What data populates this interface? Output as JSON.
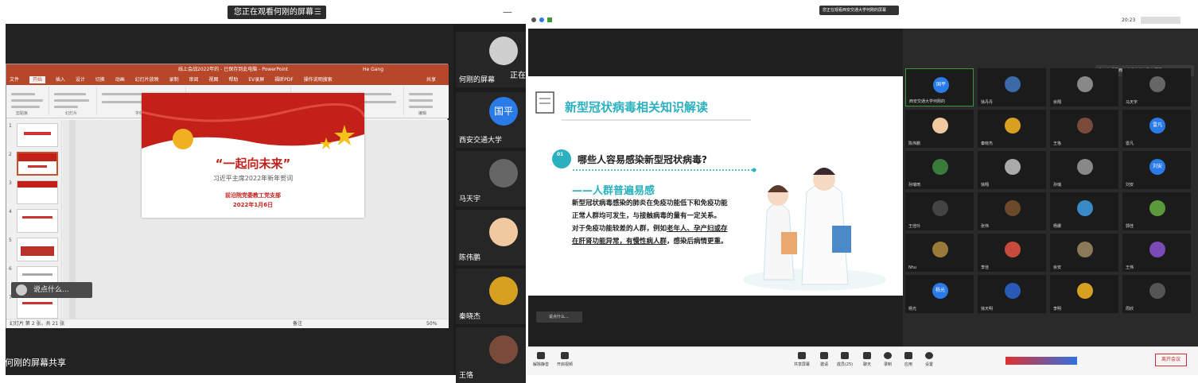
{
  "left": {
    "share_pill": "您正在观看何刚的屏幕",
    "minimize": "—",
    "tiles": [
      {
        "name": "正在",
        "color": "#cfcfcf"
      },
      {
        "name": "国平",
        "color": "#2a7ae8",
        "initials": "国平"
      },
      {
        "name": "马天宇",
        "color": "#777"
      },
      {
        "name": "陈伟鹏",
        "color": "#f0c9a0"
      },
      {
        "name": "秦晓杰",
        "color": "#d8a020"
      },
      {
        "name": "王恪",
        "color": "#7a4a3a"
      }
    ],
    "tile2_org": "西安交通大学",
    "tile1_sub": "何刚的屏幕",
    "ppt": {
      "titlebar": "线上会战2022年的 - 已保存到此电脑 - PowerPoint",
      "user": "He Gang",
      "tabs": [
        "文件",
        "开始",
        "插入",
        "设计",
        "切换",
        "动画",
        "幻灯片放映",
        "录制",
        "审阅",
        "视图",
        "帮助",
        "EV录屏",
        "福昕PDF",
        "操作说明搜索"
      ],
      "active_tab": "开始",
      "share": "共享",
      "group_labels": [
        "剪贴板",
        "幻灯片",
        "字体",
        "段落",
        "绘图",
        "编辑"
      ],
      "slide_title": "“一起向未来”",
      "slide_sub": "习近平主席2022年新年贺词",
      "slide_org": "前沿院党委教工党支部",
      "slide_date": "2022年1月6日",
      "status": "幻灯片 第 2 张，共 21 张",
      "zoom": "50%",
      "notes": "备注",
      "thumb_nums": [
        "1",
        "2",
        "3",
        "4",
        "5",
        "6",
        "7"
      ]
    },
    "search": "说点什么...",
    "bottom_label": "何刚的屏幕共享"
  },
  "right": {
    "pill": "您正在观看西安交通大学何刚的屏幕",
    "time": "20:23",
    "slide": {
      "title": "新型冠状病毒相关知识解读",
      "q_num": "01",
      "question": "哪些人容易感染新型冠状病毒?",
      "subtitle": "——人群普遍易感",
      "p1": "新型冠状病毒感染的肺炎在免疫功能低下和免疫功能",
      "p2": "正常人群均可发生，与接触病毒的量有一定关系。",
      "p3a": "对于免疫功能较差的人群，例如",
      "p3b": "老年人、孕产妇或存",
      "p4a": "在肝肾功能异常，有慢性病人群",
      "p4b": "，感染后病情更重。"
    },
    "search": "说点什么...",
    "gallery": [
      {
        "name": "西安交通大学何刚的",
        "color": "#2a7ae8",
        "initials": "国平"
      },
      {
        "name": "徐丹丹",
        "color": "#3a6aa8"
      },
      {
        "name": "余翔",
        "color": "#888"
      },
      {
        "name": "马天宇",
        "color": "#666"
      },
      {
        "name": "陈伟鹏",
        "color": "#f0c9a0"
      },
      {
        "name": "秦晓杰",
        "color": "#d8a020"
      },
      {
        "name": "王恪",
        "color": "#7a4a3a"
      },
      {
        "name": "雷凡",
        "color": "#2a7ae8",
        "initials": "雷凡"
      },
      {
        "name": "孙瑞琦",
        "color": "#3a7a3a"
      },
      {
        "name": "徐翔",
        "color": "#aaa"
      },
      {
        "name": "孙瑞",
        "color": "#888"
      },
      {
        "name": "刘安",
        "color": "#2a7ae8",
        "initials": "刘安"
      },
      {
        "name": "王佳玲",
        "color": "#444"
      },
      {
        "name": "张伟",
        "color": "#6a4a2a"
      },
      {
        "name": "杨娜",
        "color": "#3a8ac8"
      },
      {
        "name": "郭佳",
        "color": "#5a9a3a"
      },
      {
        "name": "Nhu",
        "color": "#9a7a3a"
      },
      {
        "name": "李佳",
        "color": "#c84a3a"
      },
      {
        "name": "余安",
        "color": "#8a7a5a"
      },
      {
        "name": "王伟",
        "color": "#7a4ab8"
      },
      {
        "name": "杨光",
        "color": "#2a7ae8",
        "initials": "杨光"
      },
      {
        "name": "徐天明",
        "color": "#2a5ab8"
      },
      {
        "name": "李明",
        "color": "#d8a020"
      },
      {
        "name": "周欣",
        "color": "#555"
      }
    ],
    "bottom_items": [
      "解除静音",
      "开启视频",
      "共享屏幕",
      "邀请",
      "成员(25)",
      "聊天",
      "录制",
      "应用",
      "设置"
    ],
    "leave": "离开会议",
    "tooltip": "您正在观看西安交通大学何刚的屏幕"
  }
}
